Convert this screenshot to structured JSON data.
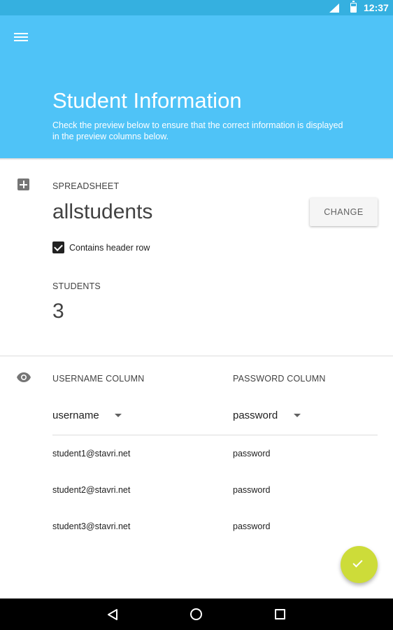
{
  "status_bar": {
    "time": "12:37"
  },
  "header": {
    "title": "Student Information",
    "subtitle": "Check the preview below to ensure that the correct information is displayed in the preview columns below."
  },
  "spreadsheet": {
    "label": "SPREADSHEET",
    "name": "allstudents",
    "change_label": "CHANGE",
    "header_row_label": "Contains header row",
    "header_row_checked": true,
    "students_label": "STUDENTS",
    "students_count": "3"
  },
  "preview": {
    "username_column_label": "USERNAME COLUMN",
    "password_column_label": "PASSWORD COLUMN",
    "username_selected": "username",
    "password_selected": "password",
    "rows": [
      {
        "username": "student1@stavri.net",
        "password": "password"
      },
      {
        "username": "student2@stavri.net",
        "password": "password"
      },
      {
        "username": "student3@stavri.net",
        "password": "password"
      }
    ]
  },
  "icons": {
    "menu": "menu-icon",
    "grid": "grid-plus-icon",
    "preview": "eye-icon",
    "fab": "check-icon",
    "nav_back": "back-icon",
    "nav_home": "home-icon",
    "nav_recent": "recent-apps-icon"
  },
  "colors": {
    "status_bar": "#35b0e0",
    "header": "#4fc3f7",
    "fab": "#cddc39"
  }
}
